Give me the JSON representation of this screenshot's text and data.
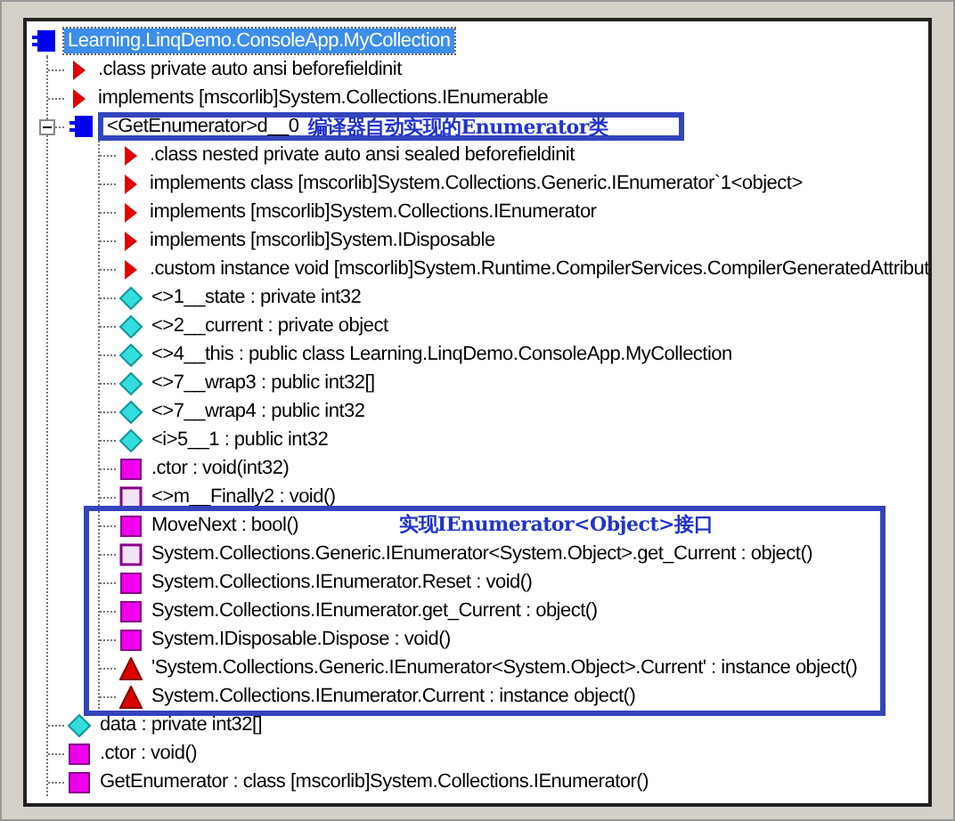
{
  "tree": {
    "label": "Learning.LinqDemo.ConsoleApp.MyCollection",
    "kind": "class",
    "selected": true,
    "children": [
      {
        "label": ".class private auto ansi beforefieldinit",
        "kind": "attribute"
      },
      {
        "label": "implements [mscorlib]System.Collections.IEnumerable",
        "kind": "attribute"
      },
      {
        "label": "<GetEnumerator>d__0",
        "kind": "class",
        "expanded": true,
        "note": "编译器自动实现的Enumerator类",
        "callout": "实现IEnumerator<Object>接口",
        "children": [
          {
            "label": ".class nested private auto ansi sealed beforefieldinit",
            "kind": "attribute",
            "boxed": false
          },
          {
            "label": "implements class [mscorlib]System.Collections.Generic.IEnumerator`1<object>",
            "kind": "attribute",
            "boxed": false
          },
          {
            "label": "implements [mscorlib]System.Collections.IEnumerator",
            "kind": "attribute",
            "boxed": false
          },
          {
            "label": "implements [mscorlib]System.IDisposable",
            "kind": "attribute",
            "boxed": false
          },
          {
            "label": ".custom instance void [mscorlib]System.Runtime.CompilerServices.CompilerGeneratedAttribut",
            "kind": "attribute",
            "boxed": false
          },
          {
            "label": "<>1__state : private int32",
            "kind": "field",
            "boxed": false
          },
          {
            "label": "<>2__current : private object",
            "kind": "field",
            "boxed": false
          },
          {
            "label": "<>4__this : public class Learning.LinqDemo.ConsoleApp.MyCollection",
            "kind": "field",
            "boxed": false
          },
          {
            "label": "<>7__wrap3 : public int32[]",
            "kind": "field",
            "boxed": false
          },
          {
            "label": "<>7__wrap4 : public int32",
            "kind": "field",
            "boxed": false
          },
          {
            "label": "<i>5__1 : public int32",
            "kind": "field",
            "boxed": false
          },
          {
            "label": ".ctor : void(int32)",
            "kind": "method",
            "boxed": false
          },
          {
            "label": "<>m__Finally2 : void()",
            "kind": "private_method",
            "boxed": false
          },
          {
            "label": "MoveNext : bool()",
            "kind": "method",
            "boxed": true
          },
          {
            "label": "System.Collections.Generic.IEnumerator<System.Object>.get_Current : object()",
            "kind": "private_method",
            "boxed": true
          },
          {
            "label": "System.Collections.IEnumerator.Reset : void()",
            "kind": "method",
            "boxed": true
          },
          {
            "label": "System.Collections.IEnumerator.get_Current : object()",
            "kind": "method",
            "boxed": true
          },
          {
            "label": "System.IDisposable.Dispose : void()",
            "kind": "method",
            "boxed": true
          },
          {
            "label": "'System.Collections.Generic.IEnumerator<System.Object>.Current' : instance object()",
            "kind": "property",
            "boxed": true
          },
          {
            "label": "System.Collections.IEnumerator.Current : instance object()",
            "kind": "property",
            "boxed": true
          }
        ]
      },
      {
        "label": "data : private int32[]",
        "kind": "field"
      },
      {
        "label": ".ctor : void()",
        "kind": "method"
      },
      {
        "label": "GetEnumerator : class [mscorlib]System.Collections.IEnumerator()",
        "kind": "method"
      }
    ]
  }
}
